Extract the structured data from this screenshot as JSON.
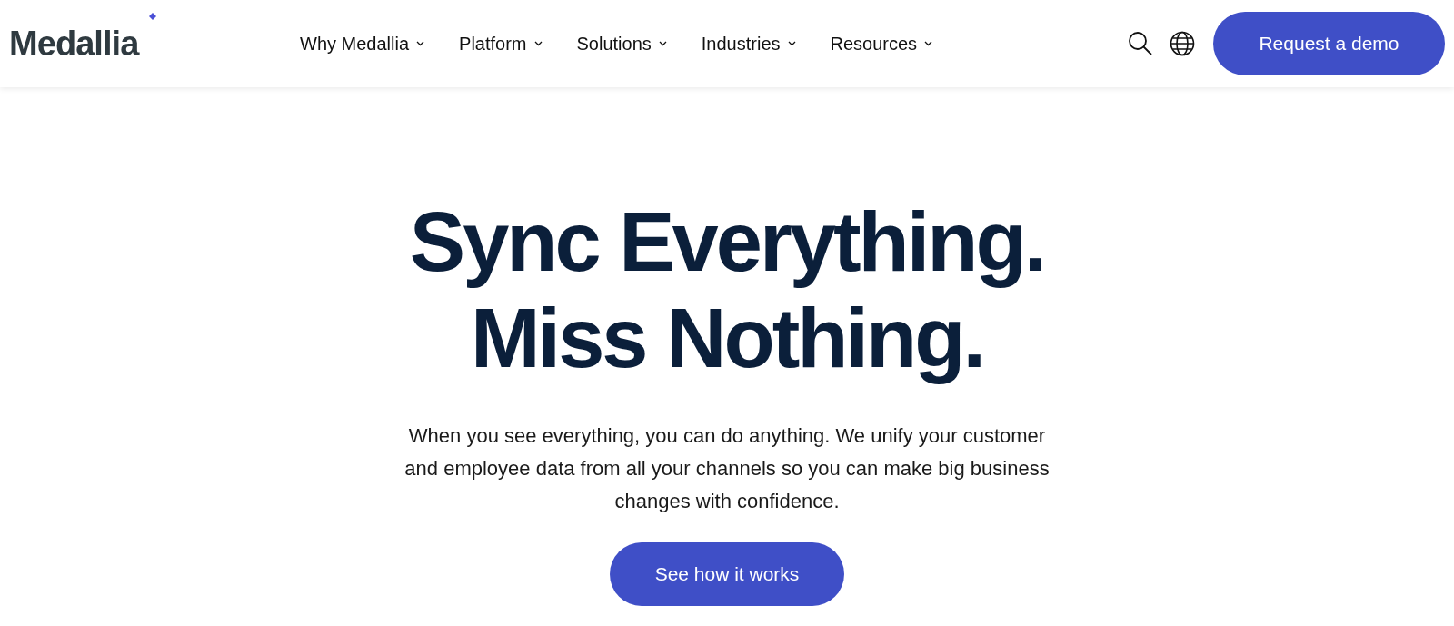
{
  "header": {
    "logo": "Medallia",
    "nav": [
      {
        "label": "Why Medallia"
      },
      {
        "label": "Platform"
      },
      {
        "label": "Solutions"
      },
      {
        "label": "Industries"
      },
      {
        "label": "Resources"
      }
    ],
    "cta": "Request a demo"
  },
  "hero": {
    "headline": [
      "Sync Everything.",
      "Miss Nothing."
    ],
    "body": "When you see everything, you can do anything. We unify your customer and employee data from all your channels so you can make big business changes with confidence.",
    "button": "See how it works"
  }
}
